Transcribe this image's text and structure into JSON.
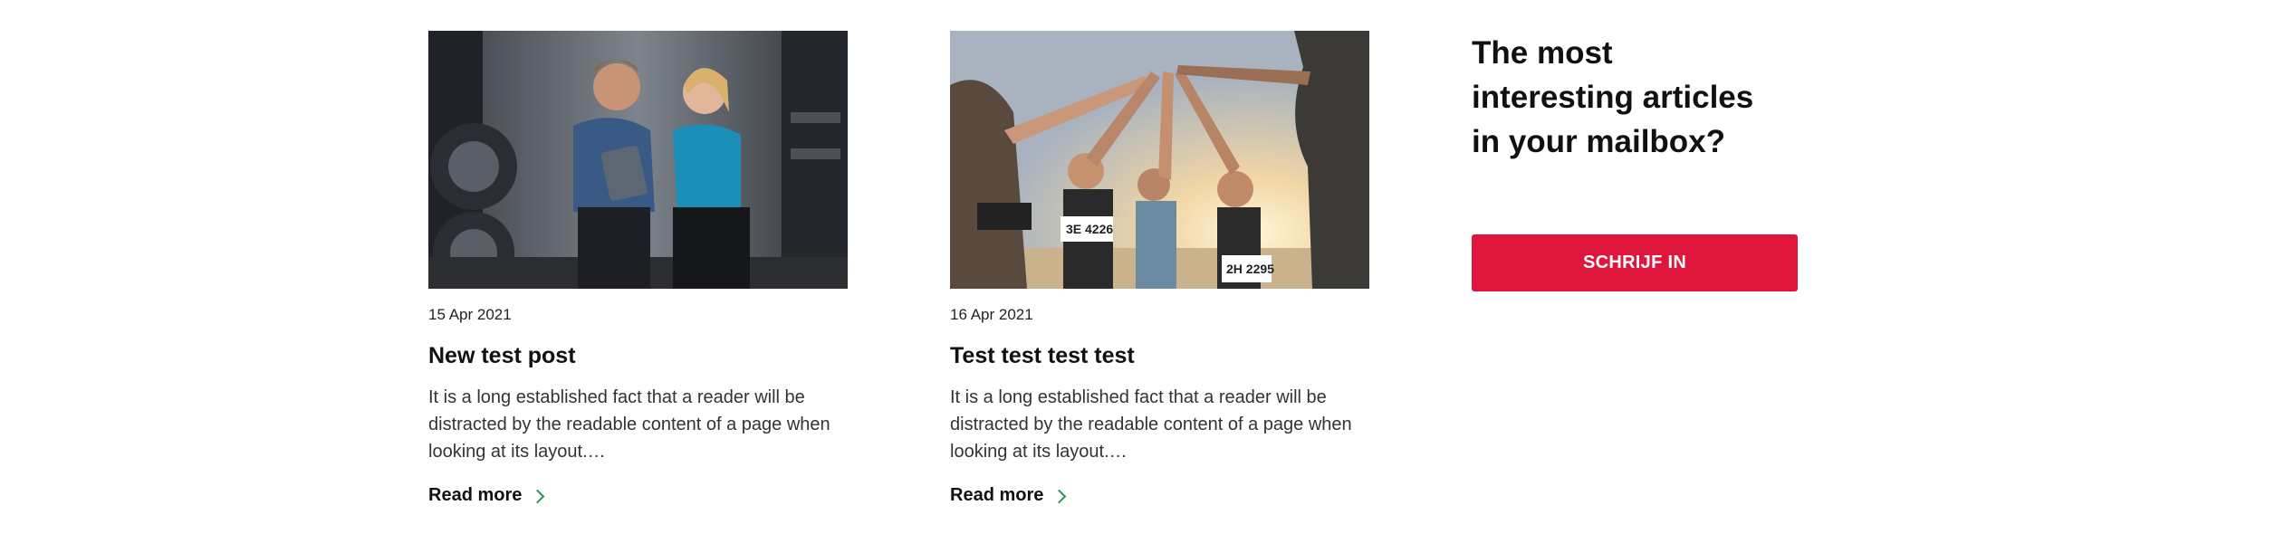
{
  "posts": [
    {
      "image_alt": "Couple looking at a tablet in a gym",
      "date": "15 Apr 2021",
      "title": "New test post",
      "excerpt": "It is a long established fact that a reader will be distracted by the readable content of a page when looking at its layout.…",
      "read_more": "Read more"
    },
    {
      "image_alt": "Runners giving a group high five at sunset",
      "date": "16 Apr 2021",
      "title": "Test test test test",
      "excerpt": "It is a long established fact that a reader will be distracted by the readable content of a page when looking at its layout.…",
      "read_more": "Read more"
    }
  ],
  "newsletter": {
    "title": "The most interesting articles in your mailbox?",
    "button_label": "SCHRIJF IN"
  },
  "colors": {
    "accent": "#e0153c",
    "chevron": "#2e8f5d"
  }
}
